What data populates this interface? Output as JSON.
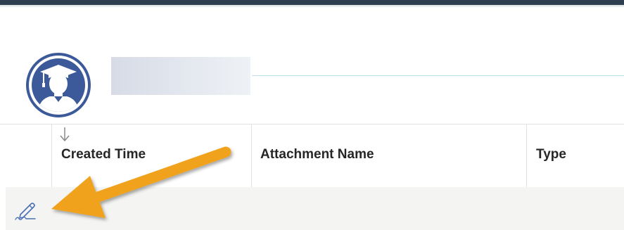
{
  "header": {
    "avatar_icon": "graduate-avatar-icon",
    "accent_color": "#3c5a9a",
    "name_redacted": true
  },
  "table": {
    "sort_indicator_icon": "sort-arrow-down-icon",
    "columns": [
      {
        "label": "Created Time"
      },
      {
        "label": "Attachment Name"
      },
      {
        "label": "Type"
      }
    ],
    "rows": [
      {
        "action_icon": "signature-pen-icon"
      }
    ]
  },
  "annotation": {
    "arrow_color": "#f0a21a",
    "icon": "callout-arrow-icon"
  }
}
